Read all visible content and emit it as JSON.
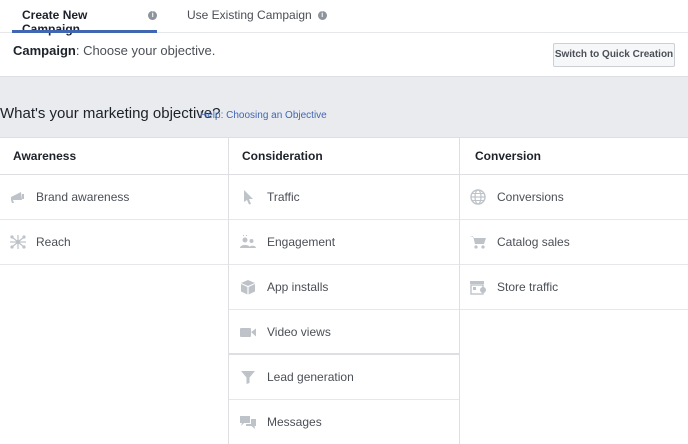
{
  "tabs": {
    "create_label": "Create New Campaign",
    "existing_label": "Use Existing Campaign"
  },
  "campaign": {
    "label": "Campaign",
    "text": ": Choose your objective.",
    "quick_button": "Switch to Quick Creation"
  },
  "objective": {
    "question": "What's your marketing objective?",
    "help": "Help: Choosing an Objective"
  },
  "columns": {
    "awareness": {
      "title": "Awareness",
      "items": [
        {
          "label": "Brand awareness",
          "icon": "megaphone-icon"
        },
        {
          "label": "Reach",
          "icon": "reach-icon"
        }
      ]
    },
    "consideration": {
      "title": "Consideration",
      "items": [
        {
          "label": "Traffic",
          "icon": "cursor-icon"
        },
        {
          "label": "Engagement",
          "icon": "people-icon"
        },
        {
          "label": "App installs",
          "icon": "box-icon"
        },
        {
          "label": "Video views",
          "icon": "video-camera-icon"
        },
        {
          "label": "Lead generation",
          "icon": "funnel-icon"
        },
        {
          "label": "Messages",
          "icon": "chat-bubbles-icon"
        }
      ]
    },
    "conversion": {
      "title": "Conversion",
      "items": [
        {
          "label": "Conversions",
          "icon": "globe-icon"
        },
        {
          "label": "Catalog sales",
          "icon": "cart-icon"
        },
        {
          "label": "Store traffic",
          "icon": "store-icon"
        }
      ]
    }
  },
  "colors": {
    "accent": "#4267b2",
    "band": "#e9ebee",
    "icon": "#bec3c9"
  }
}
